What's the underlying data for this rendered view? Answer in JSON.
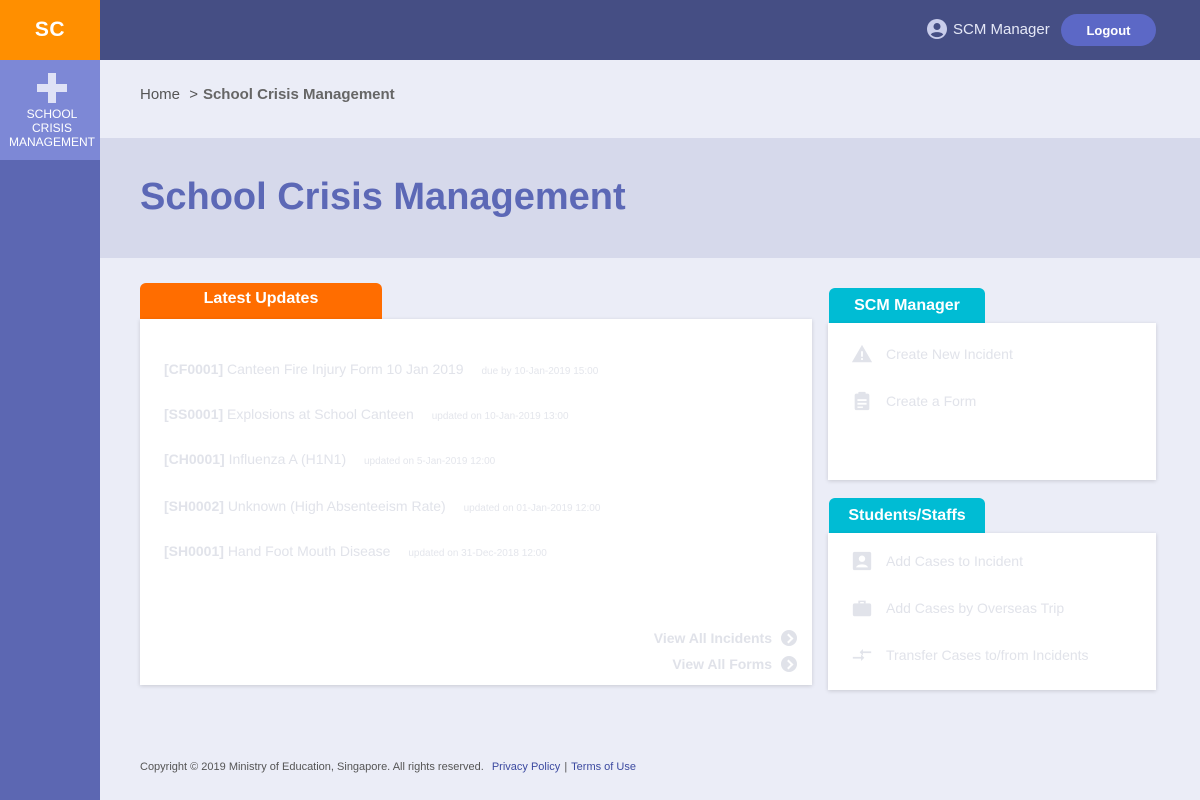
{
  "sidebar": {
    "logo": "SC",
    "nav_label": "SCHOOL\nCRISIS\nMANAGEMENT"
  },
  "header": {
    "user_name": "SCM Manager",
    "logout_label": "Logout"
  },
  "breadcrumb": {
    "home": "Home",
    "separator": ">",
    "current": "School Crisis Management"
  },
  "page_title": "School Crisis Management",
  "latest_updates": {
    "tab_label": "Latest Updates",
    "items": [
      {
        "code": "[CF0001]",
        "title": "Canteen Fire Injury Form 10 Jan 2019",
        "meta": "due by 10-Jan-2019 15:00"
      },
      {
        "code": "[SS0001]",
        "title": "Explosions at School Canteen",
        "meta": "updated on 10-Jan-2019 13:00"
      },
      {
        "code": "[CH0001]",
        "title": "Influenza A (H1N1)",
        "meta": "updated on 5-Jan-2019 12:00"
      },
      {
        "code": "[SH0002]",
        "title": "Unknown (High Absenteeism Rate)",
        "meta": "updated on 01-Jan-2019 12:00"
      },
      {
        "code": "[SH0001]",
        "title": "Hand Foot Mouth Disease",
        "meta": "updated on 31-Dec-2018 12:00"
      }
    ],
    "view_all_incidents": "View All Incidents",
    "view_all_forms": "View All Forms"
  },
  "scm_manager": {
    "tab_label": "SCM Manager",
    "actions": [
      {
        "label": "Create New Incident",
        "icon": "warning-icon"
      },
      {
        "label": "Create a Form",
        "icon": "clipboard-icon"
      }
    ]
  },
  "students_staffs": {
    "tab_label": "Students/Staffs",
    "actions": [
      {
        "label": "Add Cases to Incident",
        "icon": "contact-icon"
      },
      {
        "label": "Add Cases by Overseas Trip",
        "icon": "briefcase-icon"
      },
      {
        "label": "Transfer Cases to/from Incidents",
        "icon": "transfer-icon"
      }
    ]
  },
  "footer": {
    "copyright": "Copyright © 2019 Ministry of Education, Singapore. All rights reserved.",
    "privacy": "Privacy Policy",
    "separator": "|",
    "terms": "Terms of Use"
  },
  "colors": {
    "logo_bg": "#ff8f00",
    "sidebar_bg": "#5c67b2",
    "header_bg": "#454e84",
    "accent_orange": "#ff6d00",
    "accent_teal": "#00bcd4",
    "title_color": "#5c68b6"
  }
}
